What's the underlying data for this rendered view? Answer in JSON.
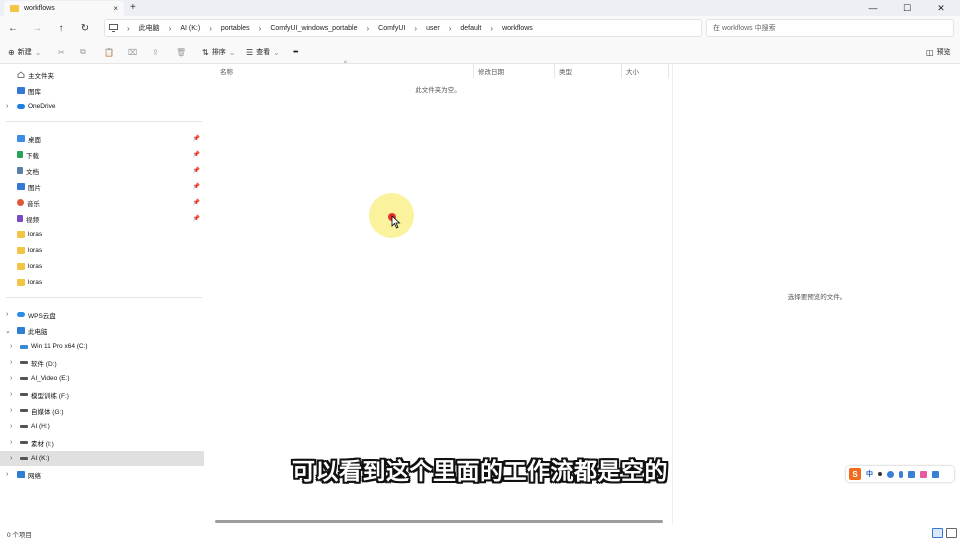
{
  "window": {
    "tab_title": "workflows",
    "tab_close": "×",
    "new_tab": "+",
    "minimize": "—",
    "maximize": "☐",
    "close": "✕"
  },
  "nav": {
    "back": "←",
    "forward": "→",
    "up": "↑",
    "refresh": "↻"
  },
  "breadcrumbs": [
    "此电脑",
    "AI (K:)",
    "portables",
    "ComfyUI_windows_portable",
    "ComfyUI",
    "user",
    "default",
    "workflows"
  ],
  "search": {
    "placeholder": "在 workflows 中搜索"
  },
  "toolbar": {
    "new_label": "新建",
    "sort_label": "排序",
    "view_label": "查看",
    "more": "•••",
    "preview_label": "预览"
  },
  "sidebar": {
    "quick": [
      {
        "label": "主文件夹",
        "icon": "home-icon"
      },
      {
        "label": "图库",
        "icon": "gallery-icon"
      },
      {
        "label": "OneDrive",
        "icon": "onedrive-icon"
      }
    ],
    "pinned": [
      {
        "label": "桌面",
        "icon": "desktop-icon",
        "color": "#3d8ee6"
      },
      {
        "label": "下载",
        "icon": "download-icon",
        "color": "#2aa35a"
      },
      {
        "label": "文档",
        "icon": "document-icon",
        "color": "#5b7fa8"
      },
      {
        "label": "图片",
        "icon": "pictures-icon",
        "color": "#3478d8"
      },
      {
        "label": "音乐",
        "icon": "music-icon",
        "color": "#e0573c"
      },
      {
        "label": "视频",
        "icon": "video-icon",
        "color": "#7b4ac7"
      },
      {
        "label": "loras",
        "icon": "folder-icon",
        "color": "#f4c545"
      },
      {
        "label": "loras",
        "icon": "folder-icon",
        "color": "#f4c545"
      },
      {
        "label": "loras",
        "icon": "folder-icon",
        "color": "#f4c545"
      },
      {
        "label": "loras",
        "icon": "folder-icon",
        "color": "#f4c545"
      }
    ],
    "wps": "WPS云盘",
    "this_pc": "此电脑",
    "drives": [
      {
        "label": "Win 11 Pro x64 (C:)",
        "icon": "windows-drive-icon"
      },
      {
        "label": "软件 (D:)",
        "icon": "drive-icon"
      },
      {
        "label": "AI_Video (E:)",
        "icon": "drive-icon"
      },
      {
        "label": "模型训练 (F:)",
        "icon": "drive-icon"
      },
      {
        "label": "自媒体 (G:)",
        "icon": "drive-icon"
      },
      {
        "label": "AI (H:)",
        "icon": "drive-icon"
      },
      {
        "label": "素材 (I:)",
        "icon": "drive-icon"
      },
      {
        "label": "AI (K:)",
        "icon": "drive-icon"
      }
    ],
    "network": "网络"
  },
  "columns": [
    "名称",
    "修改日期",
    "类型",
    "大小"
  ],
  "empty_message": "此文件夹为空。",
  "preview_message": "选择要预览的文件。",
  "status": {
    "item_count": "0 个项目"
  },
  "caption": "可以看到这个里面的工作流都是空的",
  "ime": {
    "logo": "S",
    "lang": "中"
  }
}
